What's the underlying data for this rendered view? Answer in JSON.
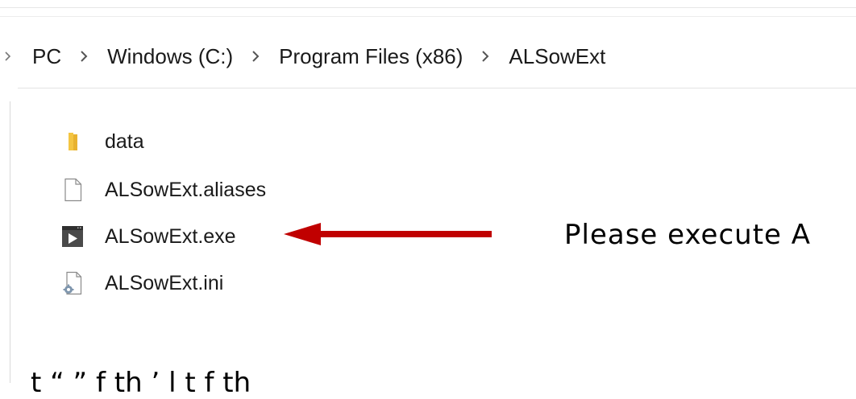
{
  "address_bar": {
    "breadcrumbs": [
      {
        "label": "PC"
      },
      {
        "label": "Windows (C:)"
      },
      {
        "label": "Program Files (x86)"
      },
      {
        "label": "ALSowExt"
      }
    ]
  },
  "files": [
    {
      "name": "data",
      "icon": "folder-icon"
    },
    {
      "name": "ALSowExt.aliases",
      "icon": "file-icon"
    },
    {
      "name": "ALSowExt.exe",
      "icon": "exe-icon"
    },
    {
      "name": "ALSowExt.ini",
      "icon": "config-file-icon"
    }
  ],
  "annotation": {
    "instruction": "Please execute A",
    "arrow_color": "#c00000"
  },
  "footer": {
    "text": "t    “ ”   f th                 ’ l t   f th"
  }
}
